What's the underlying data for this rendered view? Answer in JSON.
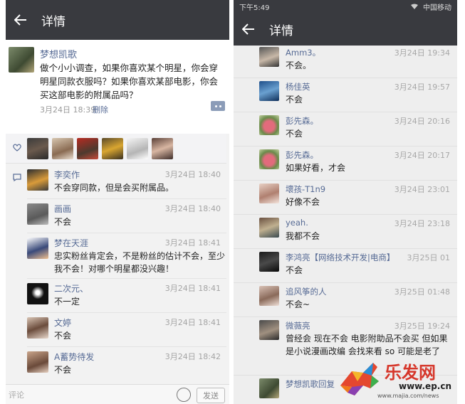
{
  "left": {
    "title": "详情",
    "post": {
      "author": "梦想凯歌",
      "text": "做个小小调查，如果你喜欢某个明星，你会穿明星同款衣服吗？如果你喜欢某部电影，你会买这部电影的附属品吗？",
      "time": "3月24日 18:39",
      "delete_label": "删除"
    },
    "comments": [
      {
        "name": "李奕作",
        "time": "3月24日 18:40",
        "text": "不会穿同款，但是会买附属品。"
      },
      {
        "name": "画画",
        "time": "3月24日 18:40",
        "text": "不会"
      },
      {
        "name": "梦在天涯",
        "time": "3月24日 18:41",
        "text": "忠实粉丝肯定会，不是粉丝的估计不会，至少我不会！对哪个明星都没兴趣！"
      },
      {
        "name": "二次元、",
        "time": "3月24日 18:41",
        "text": "不一定"
      },
      {
        "name": "文婷",
        "time": "3月24日 18:41",
        "text": "不会"
      },
      {
        "name": "A蓄势待发",
        "time": "3月24日 18:42",
        "text": "不会"
      }
    ],
    "input_placeholder": "评论",
    "send_label": "发送"
  },
  "right": {
    "status_time": "下午5:49",
    "status_carrier": "中国移动",
    "title": "详情",
    "comments": [
      {
        "name": "Amm3。",
        "time": "3月24日 19:34",
        "text": "不会。"
      },
      {
        "name": "杨佳英",
        "time": "3月24日 19:57",
        "text": "不会"
      },
      {
        "name": "彭先森。",
        "time": "3月24日 20:16",
        "text": "不会"
      },
      {
        "name": "彭先森。",
        "time": "3月24日 20:17",
        "text": "如果好看，才会"
      },
      {
        "name": "壞孩-T1n9",
        "time": "3月24日 23:01",
        "text": "好像不会"
      },
      {
        "name": "yeah.",
        "time": "3月24日 23:18",
        "text": "我都不会"
      },
      {
        "name": "李鸿亮【网络技术开发|电商】",
        "time": "3月25日 01",
        "text": "不会"
      },
      {
        "name": "追风筝的人",
        "time": "3月25日 01:48",
        "text": "不会~"
      },
      {
        "name": "微薇亮",
        "time": "3月25日 19:24",
        "text": "曾经会  现在不会  电影附助品不会买  但如果是小说漫画改编  会找来看  so  可能是老了"
      },
      {
        "name": "梦想凯歌回复",
        "time": "",
        "text": ""
      }
    ]
  },
  "watermark": {
    "brand": "乐发网",
    "url": "www.ep.cn",
    "small": "www.majia.com/news"
  },
  "colors": {
    "titlebar": "#393a3f",
    "link": "#576b95",
    "time": "#a4a4a4"
  }
}
